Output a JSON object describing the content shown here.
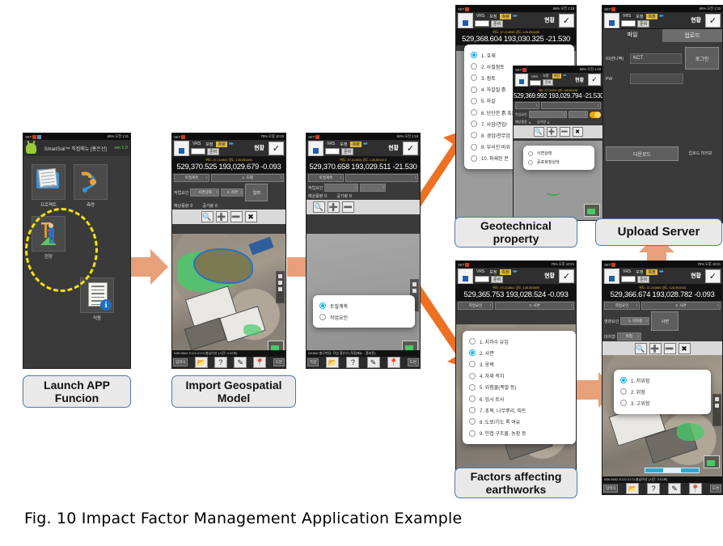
{
  "figure": {
    "caption": "Fig. 10 Impact Factor Management Application Example"
  },
  "steps": [
    {
      "id": "launch",
      "label_line1": "Launch APP",
      "label_line2": "Funcion"
    },
    {
      "id": "import",
      "label_line1": "Import Geospatial",
      "label_line2": "Model"
    },
    {
      "id": "geotech",
      "label_line1": "Geotechnical",
      "label_line2": "property"
    },
    {
      "id": "upload",
      "label_line1": "Upload Server",
      "label_line2": ""
    },
    {
      "id": "earthworks",
      "label_line1": "Factors affecting",
      "label_line2": "earthworks"
    }
  ],
  "phone1": {
    "status": {
      "carrier": "SKT",
      "right": "66% 오전 1:21"
    },
    "app_title": "SmartSoil™ 직접메뉴 [홍은선]",
    "version": "ver.1.0",
    "icons": [
      {
        "name": "프로젝트",
        "glyph": "folder-documents-icon"
      },
      {
        "name": "측량",
        "glyph": "cable-connector-icon"
      },
      {
        "name": "현장",
        "glyph": "surveyor-worker-icon"
      },
      {
        "name": "적용",
        "glyph": "document-info-icon"
      }
    ],
    "highlight_target": "현장"
  },
  "phone2": {
    "status": {
      "carrier": "SKT",
      "right": "79% 오후 10:19"
    },
    "tabs": {
      "vrs": "VRS",
      "pos": "보정",
      "fix": "측량",
      "ready": "준비",
      "title": "현황"
    },
    "coord_label": "위도: 37.214902    경도: 126.551694",
    "coords": "529,370.525  193,029.679  -0.093",
    "selects": {
      "left": "토질계측",
      "right": "1. 호재",
      "row2_label": "작업요인",
      "row2_a": "사면상태",
      "row2_b": "2. 사면",
      "action": "입력"
    },
    "fields": {
      "label_a": "예상풍량",
      "val_a": "0",
      "label_b": "공기량",
      "val_b": "0"
    },
    "tools": [
      "search-icon",
      "plus-icon",
      "minus-icon",
      "expand-icon"
    ],
    "statusline": "N36.5502 E122.2173 충남아산 (시간: 0.02초)",
    "bottombar": {
      "left_sel": "입력식",
      "icons": [
        "folder-icon",
        "help-icon",
        "pencil-icon",
        "pin-icon"
      ],
      "right_sel": "도면"
    }
  },
  "phone3": {
    "status": {
      "carrier": "SKT",
      "right": "66% 오전 1:18"
    },
    "tabs": {
      "vrs": "VRS",
      "pos": "보정",
      "fix": "측량",
      "ready": "준비",
      "title": "현황"
    },
    "coord_label": "위도: 37.214904    경도: 126.551613",
    "coords": "529,370.658  193,029.511  -21.530",
    "select_left": "토질계측",
    "fields": {
      "label_a": "예상풍량",
      "val_a": "0",
      "label_b": "공기량",
      "val_b": "0",
      "row_label": "작업요인"
    },
    "dialog": {
      "options": [
        {
          "label": "토질계측",
          "selected": true
        },
        {
          "label": "작업요인",
          "selected": false
        }
      ]
    },
    "statusline": "GK500 충무현장, 작업 홍은선 (직접메뉴→홈버튼)",
    "bottombar": {
      "left_sel": "측량",
      "icons": [
        "folder-icon",
        "help-icon",
        "pencil-icon",
        "pin-icon"
      ],
      "right_sel": "도면"
    }
  },
  "phone4": {
    "status": {
      "carrier": "SKT",
      "right": "66% 오전 1:18"
    },
    "tabs": {
      "vrs": "VRS",
      "pos": "보정",
      "fix": "측량",
      "ready": "준비",
      "title": "현황"
    },
    "coord_label": "위도: 37.214896    경도: 126.551636",
    "coords": "529,368.604  193,030.325  -21.530",
    "dialog": {
      "options": [
        {
          "label": "1. 호재",
          "selected": true
        },
        {
          "label": "2. 사질점토",
          "selected": false
        },
        {
          "label": "3. 점토",
          "selected": false
        },
        {
          "label": "4. 자갈질 흙",
          "selected": false
        },
        {
          "label": "5. 자갈",
          "selected": false
        },
        {
          "label": "6. 단단한 흙 혹은",
          "selected": false
        },
        {
          "label": "7. 사암/연암/",
          "selected": false
        },
        {
          "label": "8. 경암/천무암",
          "selected": false
        },
        {
          "label": "9. 부서진 바위",
          "selected": false
        },
        {
          "label": "10. 파쇄된 콘",
          "selected": false
        }
      ]
    }
  },
  "phone5": {
    "status": {
      "carrier": "SKT",
      "right": "66% 오전 1:19"
    },
    "coord_label": "위도: 37.214901    경도: 126.551635",
    "coords": "529,369.992  193,029.794  -21.530",
    "toggle_on": true,
    "tools": [
      "search-icon",
      "plus-icon",
      "minus-icon",
      "expand-icon"
    ],
    "dialog": {
      "options": [
        {
          "label": "사면상태",
          "selected": false
        },
        {
          "label": "흙포화정상태",
          "selected": false
        }
      ]
    }
  },
  "phone6": {
    "status": {
      "carrier": "SKT",
      "right": "66% 오전 1:33"
    },
    "tabs": {
      "vrs": "VRS",
      "pos": "보정",
      "fix": "측정",
      "ready": "준비",
      "title": "현황"
    },
    "subtabs": [
      {
        "label": "파일",
        "active": true
      },
      {
        "label": "업로드",
        "active": false
      }
    ],
    "form": {
      "id_label": "ID(현나팩)",
      "id_value": "KCT",
      "pw_label": "PW",
      "pw_value": "",
      "login_button": "로그인"
    },
    "actions": {
      "download": "다운로드",
      "upload": "업로드 미리보"
    }
  },
  "phone7": {
    "status": {
      "carrier": "SKT",
      "right": "79% 오후 10:21"
    },
    "tabs": {
      "vrs": "VRS",
      "pos": "보정",
      "fix": "측정",
      "ready": "준비",
      "title": "현황"
    },
    "coord_label": "위도: 37.214861    경도: 126.551869",
    "coords": "529,365.753  193,028.524  -0.093",
    "selects": {
      "left": "작업요인",
      "right": "2. 사면"
    },
    "dialog": {
      "options": [
        {
          "label": "1. 지하수 유입",
          "selected": false
        },
        {
          "label": "2. 사면",
          "selected": true
        },
        {
          "label": "3. 옹벽",
          "selected": false
        },
        {
          "label": "4. 자재 적치",
          "selected": false
        },
        {
          "label": "5. 위험물(폭발 등)",
          "selected": false
        },
        {
          "label": "6. 임시 토사",
          "selected": false
        },
        {
          "label": "7. 초목, 나무뿌리, 피트",
          "selected": false
        },
        {
          "label": "8. 도로/기도 록 여유",
          "selected": false
        },
        {
          "label": "9. 인접 구조물, 농장 등",
          "selected": false
        }
      ]
    }
  },
  "phone8": {
    "status": {
      "carrier": "SKT",
      "right": "79% 오후 10:21"
    },
    "tabs": {
      "vrs": "VRS",
      "pos": "보정",
      "fix": "측정",
      "ready": "준비",
      "title": "현황"
    },
    "coord_label": "위도: 37.214860    경도: 126.551630",
    "coords": "529,366.674  193,028.782  -0.093",
    "selects": {
      "left": "작업요인",
      "right": "2. 사면"
    },
    "fields": {
      "label_a": "영향요인",
      "val_a": "1. 지하철",
      "label_b": "대처형",
      "val_b": "위험",
      "action": "사면"
    },
    "tools": [
      "search-icon",
      "plus-icon",
      "minus-icon",
      "expand-icon"
    ],
    "dialog": {
      "options": [
        {
          "label": "1. 저위험",
          "selected": true
        },
        {
          "label": "2. 위험",
          "selected": false
        },
        {
          "label": "3. 고위험",
          "selected": false
        }
      ]
    },
    "statusline": "N36.5502 E122.2173 충남아산 (시간: 3.02초)",
    "bottombar": {
      "left_sel": "입력식",
      "icons": [
        "folder-icon",
        "help-icon",
        "pencil-icon",
        "pin-icon"
      ],
      "right_sel": "도면"
    }
  },
  "colors": {
    "arrow": "#e8a07a",
    "arrow_strong": "#ee7023",
    "highlight": "#f5e400",
    "caption_border": "#4a77b5",
    "radio_selected": "#19b4e8"
  }
}
